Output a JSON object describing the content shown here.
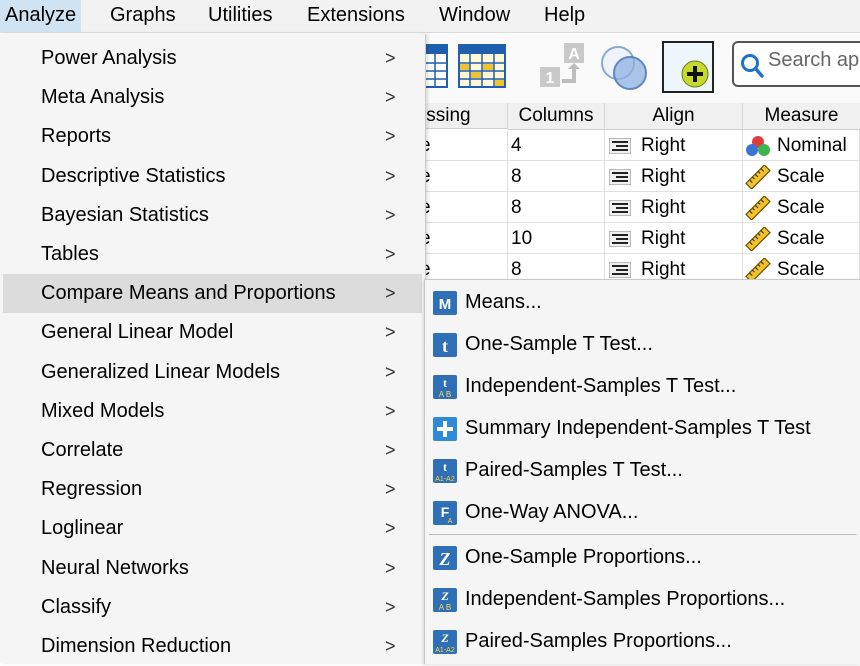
{
  "menubar": [
    {
      "label": "Analyze",
      "active": true
    },
    {
      "label": "Graphs"
    },
    {
      "label": "Utilities"
    },
    {
      "label": "Extensions"
    },
    {
      "label": "Window"
    },
    {
      "label": "Help"
    }
  ],
  "toolbar": {
    "search_placeholder": "Search ap",
    "icons": [
      "data-view-icon",
      "variable-view-icon",
      "value-labels-icon",
      "use-sets-icon",
      "add-extension-icon",
      "search-icon"
    ]
  },
  "grid": {
    "headers": [
      "issing",
      "Columns",
      "Align",
      "Measure"
    ],
    "rows": [
      {
        "missing": "e",
        "columns": "4",
        "align": "Right",
        "measure": "Nominal",
        "measure_icon": "nominal-icon"
      },
      {
        "missing": "e",
        "columns": "8",
        "align": "Right",
        "measure": "Scale",
        "measure_icon": "scale-ruler-icon"
      },
      {
        "missing": "e",
        "columns": "8",
        "align": "Right",
        "measure": "Scale",
        "measure_icon": "scale-ruler-icon"
      },
      {
        "missing": "e",
        "columns": "10",
        "align": "Right",
        "measure": "Scale",
        "measure_icon": "scale-ruler-icon"
      },
      {
        "missing": "e",
        "columns": "8",
        "align": "Right",
        "measure": "Scale",
        "measure_icon": "scale-ruler-icon"
      }
    ]
  },
  "analyze_menu": [
    {
      "label": "Power Analysis"
    },
    {
      "label": "Meta Analysis"
    },
    {
      "label": "Reports"
    },
    {
      "label": "Descriptive Statistics"
    },
    {
      "label": "Bayesian Statistics"
    },
    {
      "label": "Tables"
    },
    {
      "label": "Compare Means and Proportions",
      "highlighted": true
    },
    {
      "label": "General Linear Model"
    },
    {
      "label": "Generalized Linear Models"
    },
    {
      "label": "Mixed Models"
    },
    {
      "label": "Correlate"
    },
    {
      "label": "Regression"
    },
    {
      "label": "Loglinear"
    },
    {
      "label": "Neural Networks"
    },
    {
      "label": "Classify"
    },
    {
      "label": "Dimension Reduction"
    }
  ],
  "submenu_arrow": ">",
  "compare_means_submenu": [
    {
      "label": "Means...",
      "icon": "means-icon"
    },
    {
      "label": "One-Sample T Test...",
      "icon": "one-sample-t-test-icon"
    },
    {
      "label": "Independent-Samples T Test...",
      "icon": "independent-samples-t-test-icon"
    },
    {
      "label": "Summary Independent-Samples T Test",
      "icon": "summary-t-test-icon"
    },
    {
      "label": "Paired-Samples T Test...",
      "icon": "paired-samples-t-test-icon"
    },
    {
      "label": "One-Way ANOVA...",
      "icon": "one-way-anova-icon"
    },
    {
      "label": "One-Sample Proportions...",
      "icon": "one-sample-proportions-icon"
    },
    {
      "label": "Independent-Samples Proportions...",
      "icon": "independent-samples-proportions-icon"
    },
    {
      "label": "Paired-Samples Proportions...",
      "icon": "paired-samples-proportions-icon"
    }
  ],
  "colors": {
    "menu_bg": "#f5f5f5",
    "highlight": "#dcdcdc",
    "menubar_active": "#cfe3f3",
    "icon_blue": "#2f6fb5"
  }
}
